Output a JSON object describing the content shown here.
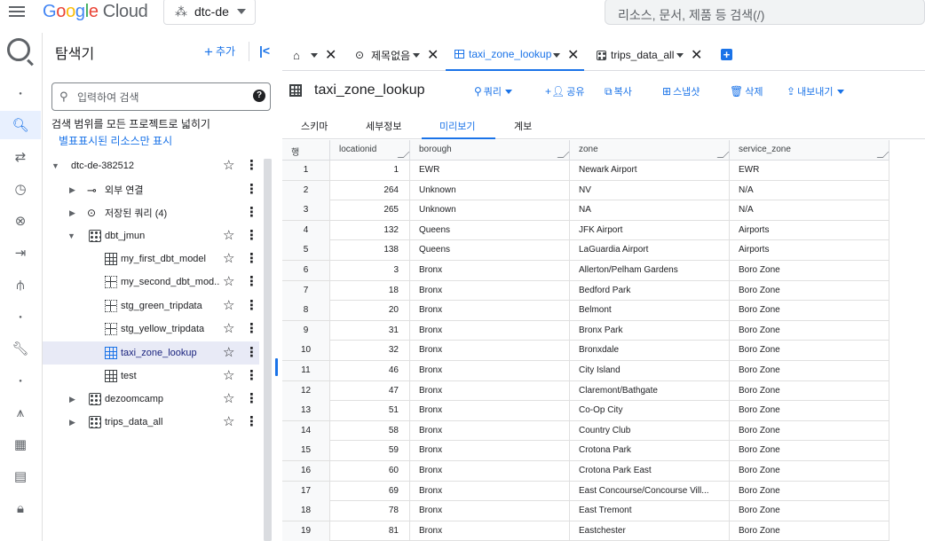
{
  "topbar": {
    "logo_letters": [
      "G",
      "o",
      "o",
      "g",
      "l",
      "e"
    ],
    "logo_suffix": "Cloud",
    "project": "dtc-de",
    "search_placeholder": "리소스, 문서, 제품 등 검색(/)"
  },
  "colors": {
    "accent": "#1a73e8",
    "selected_row": "#e8eaf6",
    "border": "#dadce0"
  },
  "rail": {
    "icons": [
      "bigquery-logo",
      "dot-icon",
      "search-icon",
      "transfer-icon",
      "clock-icon",
      "analytics-hub-icon",
      "pipeline-icon",
      "graph-icon",
      "dot-icon",
      "wrench-icon",
      "dot-icon",
      "chart-icon",
      "dashboard-icon",
      "table-icon",
      "lock-icon"
    ]
  },
  "explorer": {
    "title": "탐색기",
    "add_label": "추가",
    "search_placeholder": "입력하여 검색",
    "scope_text": "검색 범위를 모든 프로젝트로 넓히기",
    "starred_link": "별표표시된 리소스만 표시",
    "tree": [
      {
        "label": "dtc-de-382512",
        "level": 0,
        "expanded": true,
        "icon": "none"
      },
      {
        "label": "외부 연결",
        "level": 1,
        "expanded": false,
        "icon": "connection"
      },
      {
        "label": "저장된 쿼리 (4)",
        "level": 1,
        "expanded": false,
        "icon": "query"
      },
      {
        "label": "dbt_jmun",
        "level": 1,
        "expanded": true,
        "icon": "dataset"
      },
      {
        "label": "my_first_dbt_model",
        "level": 2,
        "icon": "table"
      },
      {
        "label": "my_second_dbt_mod...",
        "level": 2,
        "icon": "view"
      },
      {
        "label": "stg_green_tripdata",
        "level": 2,
        "icon": "view"
      },
      {
        "label": "stg_yellow_tripdata",
        "level": 2,
        "icon": "view"
      },
      {
        "label": "taxi_zone_lookup",
        "level": 2,
        "icon": "table",
        "selected": true
      },
      {
        "label": "test",
        "level": 2,
        "icon": "table"
      },
      {
        "label": "dezoomcamp",
        "level": 1,
        "expanded": false,
        "icon": "dataset"
      },
      {
        "label": "trips_data_all",
        "level": 1,
        "expanded": false,
        "icon": "dataset"
      }
    ]
  },
  "tabs": [
    {
      "label": "",
      "icon": "home-icon"
    },
    {
      "label": "제목없음",
      "icon": "query-icon"
    },
    {
      "label": "taxi_zone_lookup",
      "icon": "table-icon",
      "active": true
    },
    {
      "label": "trips_data_all",
      "icon": "dataset-icon"
    }
  ],
  "table_header": {
    "name": "taxi_zone_lookup",
    "actions": [
      {
        "label": "쿼리",
        "icon": "search-icon",
        "dropdown": true
      },
      {
        "label": "공유",
        "icon": "person-add-icon"
      },
      {
        "label": "복사",
        "icon": "copy-icon"
      },
      {
        "label": "스냅샷",
        "icon": "snapshot-icon"
      },
      {
        "label": "삭제",
        "icon": "trash-icon"
      },
      {
        "label": "내보내기",
        "icon": "export-icon",
        "dropdown": true
      }
    ]
  },
  "subtabs": [
    {
      "label": "스키마"
    },
    {
      "label": "세부정보"
    },
    {
      "label": "미리보기",
      "active": true
    },
    {
      "label": "계보"
    }
  ],
  "grid": {
    "columns": [
      "행",
      "locationid",
      "borough",
      "zone",
      "service_zone"
    ],
    "rows": [
      [
        "1",
        "1",
        "EWR",
        "Newark Airport",
        "EWR"
      ],
      [
        "2",
        "264",
        "Unknown",
        "NV",
        "N/A"
      ],
      [
        "3",
        "265",
        "Unknown",
        "NA",
        "N/A"
      ],
      [
        "4",
        "132",
        "Queens",
        "JFK Airport",
        "Airports"
      ],
      [
        "5",
        "138",
        "Queens",
        "LaGuardia Airport",
        "Airports"
      ],
      [
        "6",
        "3",
        "Bronx",
        "Allerton/Pelham Gardens",
        "Boro Zone"
      ],
      [
        "7",
        "18",
        "Bronx",
        "Bedford Park",
        "Boro Zone"
      ],
      [
        "8",
        "20",
        "Bronx",
        "Belmont",
        "Boro Zone"
      ],
      [
        "9",
        "31",
        "Bronx",
        "Bronx Park",
        "Boro Zone"
      ],
      [
        "10",
        "32",
        "Bronx",
        "Bronxdale",
        "Boro Zone"
      ],
      [
        "11",
        "46",
        "Bronx",
        "City Island",
        "Boro Zone"
      ],
      [
        "12",
        "47",
        "Bronx",
        "Claremont/Bathgate",
        "Boro Zone"
      ],
      [
        "13",
        "51",
        "Bronx",
        "Co-Op City",
        "Boro Zone"
      ],
      [
        "14",
        "58",
        "Bronx",
        "Country Club",
        "Boro Zone"
      ],
      [
        "15",
        "59",
        "Bronx",
        "Crotona Park",
        "Boro Zone"
      ],
      [
        "16",
        "60",
        "Bronx",
        "Crotona Park East",
        "Boro Zone"
      ],
      [
        "17",
        "69",
        "Bronx",
        "East Concourse/Concourse Vill...",
        "Boro Zone"
      ],
      [
        "18",
        "78",
        "Bronx",
        "East Tremont",
        "Boro Zone"
      ],
      [
        "19",
        "81",
        "Bronx",
        "Eastchester",
        "Boro Zone"
      ]
    ]
  }
}
